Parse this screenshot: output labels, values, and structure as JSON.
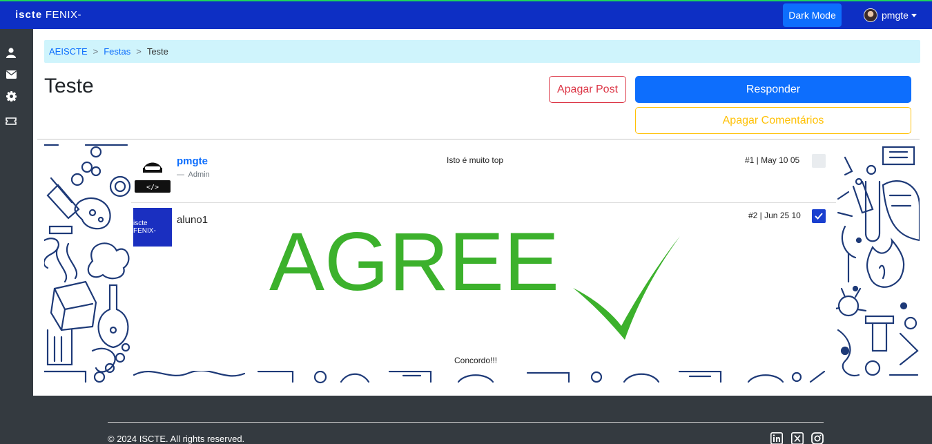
{
  "navbar": {
    "brand_prefix": "iscte",
    "brand_suffix": "FENIX-",
    "dark_mode_label": "Dark Mode",
    "username": "pmgte"
  },
  "sidebar": {
    "items": [
      {
        "icon": "user-icon"
      },
      {
        "icon": "envelope-icon"
      },
      {
        "icon": "gear-icon"
      },
      {
        "icon": "ticket-icon"
      }
    ]
  },
  "breadcrumb": {
    "items": [
      "AEISCTE",
      "Festas"
    ],
    "separator": ">",
    "current": "Teste"
  },
  "page": {
    "title": "Teste",
    "delete_post_label": "Apagar Post",
    "reply_label": "Responder",
    "delete_comments_label": "Apagar Comentários"
  },
  "posts": [
    {
      "author": "pmgte",
      "role_dash": "—",
      "role": "Admin",
      "text": "Isto é muito top",
      "meta": "#1 | May 10 05",
      "checked": false,
      "avatar": "hacker-avatar-icon"
    },
    {
      "author": "aluno1",
      "avatar_text": "iscte FENIX-",
      "image_text": "AGREE",
      "text": "Concordo!!!",
      "meta": "#2 | Jun 25 10",
      "checked": true
    }
  ],
  "footer": {
    "copyright": "© 2024 ISCTE. All rights reserved.",
    "social": [
      "linkedin-icon",
      "x-icon",
      "instagram-icon"
    ]
  },
  "colors": {
    "navbar": "#0d2fc4",
    "primary": "#0d6efd",
    "danger": "#dc3545",
    "warning": "#ffc107",
    "agree_green": "#3cb12c",
    "sidebar": "#343a40"
  }
}
